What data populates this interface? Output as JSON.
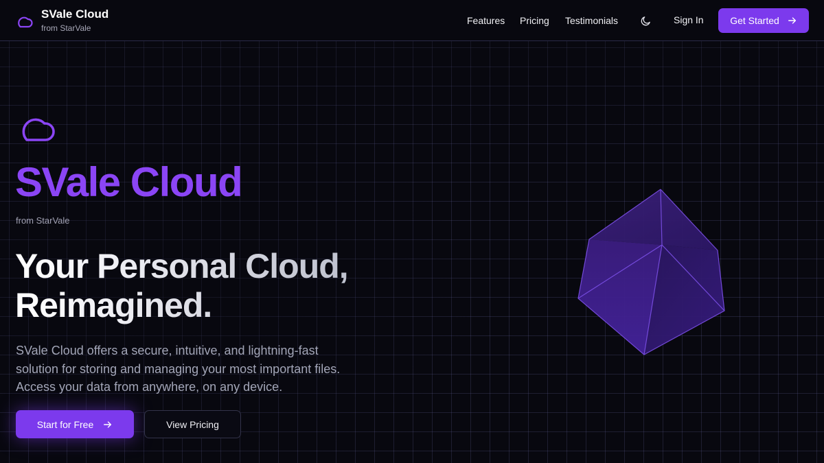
{
  "colors": {
    "accent": "#7c3aed",
    "title_purple": "#8b45f5",
    "background": "#08080f",
    "grid_line": "#2a2a48"
  },
  "navbar": {
    "brand_name": "SVale Cloud",
    "brand_sub": "from StarVale",
    "brand_icon": "cloud-icon",
    "links": [
      "Features",
      "Pricing",
      "Testimonials"
    ],
    "theme_icon": "moon-icon",
    "sign_in": "Sign In",
    "cta": "Get Started",
    "cta_icon": "arrow-right-icon"
  },
  "hero": {
    "icon": "cloud-icon",
    "title": "SVale Cloud",
    "from": "from StarVale",
    "headline_line1": "Your Personal Cloud,",
    "headline_line2": "Reimagined.",
    "desc_line1": "SVale Cloud offers a secure, intuitive, and lightning-fast",
    "desc_line2": "solution for storing and managing your most important files.",
    "desc_line3": "Access your data from anywhere, on any device.",
    "primary_button": "Start for Free",
    "primary_icon": "arrow-right-icon",
    "secondary_button": "View Pricing",
    "illustration": "cube-illustration"
  }
}
